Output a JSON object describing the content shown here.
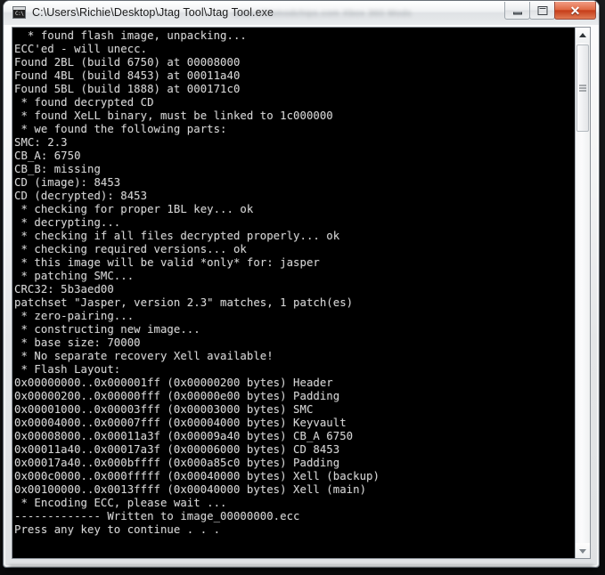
{
  "window": {
    "title": "C:\\Users\\Richie\\Desktop\\Jtag Tool\\Jtag Tool.exe",
    "watermark": "www.elitemodchips.com  Xbox 360 Mods",
    "icon_name": "console-app-icon",
    "icon_prompt": "C:\\",
    "controls": {
      "minimize_label": "Minimize",
      "maximize_label": "Maximize",
      "close_label": "Close"
    }
  },
  "console": {
    "background_color": "#000000",
    "text_color": "#d4d4d4",
    "output": "  * found flash image, unpacking...\nECC'ed - will unecc.\nFound 2BL (build 6750) at 00008000\nFound 4BL (build 8453) at 00011a40\nFound 5BL (build 1888) at 000171c0\n * found decrypted CD\n * found XeLL binary, must be linked to 1c000000\n * we found the following parts:\nSMC: 2.3\nCB_A: 6750\nCB_B: missing\nCD (image): 8453\nCD (decrypted): 8453\n * checking for proper 1BL key... ok\n * decrypting...\n * checking if all files decrypted properly... ok\n * checking required versions... ok\n * this image will be valid *only* for: jasper\n * patching SMC...\nCRC32: 5b3aed00\npatchset \"Jasper, version 2.3\" matches, 1 patch(es)\n * zero-pairing...\n * constructing new image...\n * base size: 70000\n * No separate recovery Xell available!\n * Flash Layout:\n0x00000000..0x000001ff (0x00000200 bytes) Header\n0x00000200..0x00000fff (0x00000e00 bytes) Padding\n0x00001000..0x00003fff (0x00003000 bytes) SMC\n0x00004000..0x00007fff (0x00004000 bytes) Keyvault\n0x00008000..0x00011a3f (0x00009a40 bytes) CB_A 6750\n0x00011a40..0x00017a3f (0x00006000 bytes) CD 8453\n0x00017a40..0x000bffff (0x000a85c0 bytes) Padding\n0x000c0000..0x000fffff (0x00040000 bytes) Xell (backup)\n0x00100000..0x0013ffff (0x00040000 bytes) Xell (main)\n * Encoding ECC, please wait ...\n------------- Written to image_00000000.ecc\nPress any key to continue . . ."
  },
  "scrollbar": {
    "up_arrow_label": "Scroll up",
    "down_arrow_label": "Scroll down",
    "thumb_label": "Scroll thumb"
  }
}
